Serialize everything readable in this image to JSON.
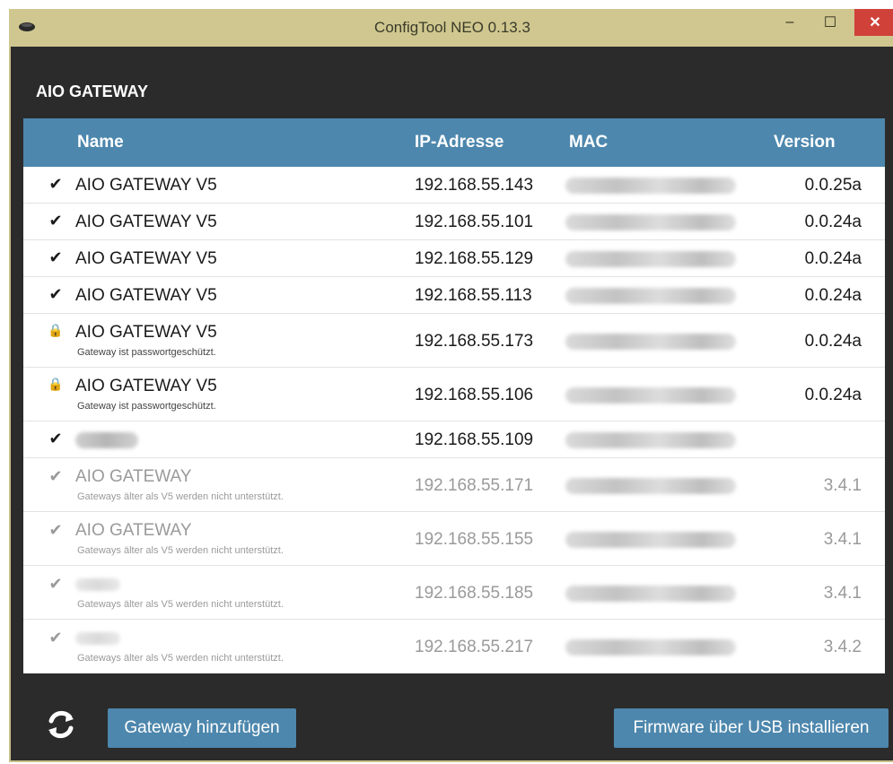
{
  "window": {
    "title": "ConfigTool NEO 0.13.3",
    "minimize_label": "–",
    "maximize_label": "☐",
    "close_label": "✕"
  },
  "section_title": "AIO GATEWAY",
  "table": {
    "columns": [
      "Name",
      "IP-Adresse",
      "MAC",
      "Version"
    ],
    "rows": [
      {
        "status": "✔",
        "name": "AIO GATEWAY V5",
        "note": "",
        "ip": "192.168.55.143",
        "version": "0.0.25a"
      },
      {
        "status": "✔",
        "name": "AIO GATEWAY V5",
        "note": "",
        "ip": "192.168.55.101",
        "version": "0.0.24a"
      },
      {
        "status": "✔",
        "name": "AIO GATEWAY V5",
        "note": "",
        "ip": "192.168.55.129",
        "version": "0.0.24a"
      },
      {
        "status": "✔",
        "name": "AIO GATEWAY V5",
        "note": "",
        "ip": "192.168.55.113",
        "version": "0.0.24a"
      },
      {
        "status": "🔒",
        "name": "AIO GATEWAY V5",
        "note": "Gateway ist passwortgeschützt.",
        "ip": "192.168.55.173",
        "version": "0.0.24a"
      },
      {
        "status": "🔒",
        "name": "AIO GATEWAY V5",
        "note": "Gateway ist passwortgeschützt.",
        "ip": "192.168.55.106",
        "version": "0.0.24a"
      },
      {
        "status": "✔",
        "name": "",
        "note": "",
        "ip": "192.168.55.109",
        "version": ""
      },
      {
        "status": "✔",
        "name": "AIO GATEWAY",
        "note": "Gateways älter als V5 werden nicht unterstützt.",
        "ip": "192.168.55.171",
        "version": "3.4.1"
      },
      {
        "status": "✔",
        "name": "AIO GATEWAY",
        "note": "Gateways älter als V5 werden nicht unterstützt.",
        "ip": "192.168.55.155",
        "version": "3.4.1"
      },
      {
        "status": "✔",
        "name": "",
        "note": "Gateways älter als V5 werden nicht unterstützt.",
        "ip": "192.168.55.185",
        "version": "3.4.1"
      },
      {
        "status": "✔",
        "name": "",
        "note": "Gateways älter als V5 werden nicht unterstützt.",
        "ip": "192.168.55.217",
        "version": "3.4.2"
      }
    ]
  },
  "buttons": {
    "refresh_icon": "refresh-icon",
    "add_gateway": "Gateway hinzufügen",
    "usb_firmware": "Firmware über USB installieren"
  },
  "colors": {
    "header_bg": "#4d87ad",
    "client_bg": "#2b2b2b",
    "frame": "#c8c08a",
    "close_button": "#d0413a"
  }
}
